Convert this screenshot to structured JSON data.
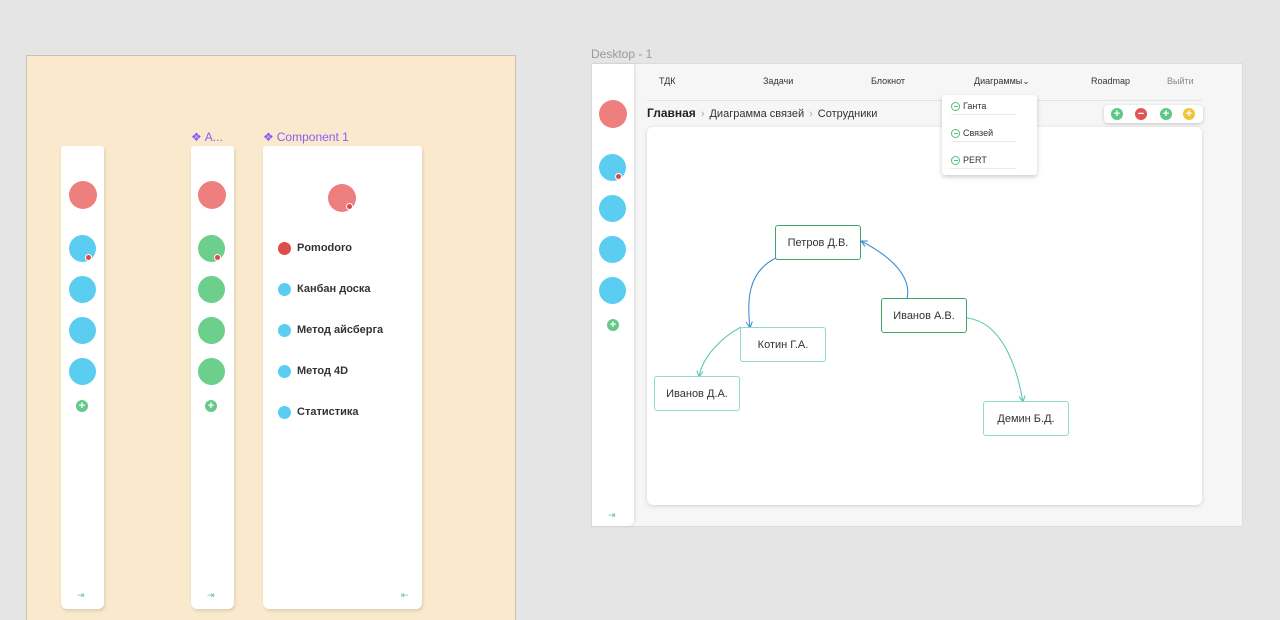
{
  "board": {
    "strip2_label": "A...",
    "component_label": "Component 1",
    "component_menu": [
      {
        "label": "Pomodoro",
        "color": "#e04b4b"
      },
      {
        "label": "Канбан доска",
        "color": "#5acdf0"
      },
      {
        "label": "Метод айсберга",
        "color": "#5acdf0"
      },
      {
        "label": "Метод 4D",
        "color": "#5acdf0"
      },
      {
        "label": "Статистика",
        "color": "#5acdf0"
      }
    ]
  },
  "desktop": {
    "frame_title": "Desktop - 1",
    "nav": {
      "tdk": "ТДК",
      "tasks": "Задачи",
      "notebook": "Блокнот",
      "diagrams": "Диаграммы",
      "diagrams_chevron": "⌄",
      "roadmap": "Roadmap",
      "logout": "Выйти"
    },
    "breadcrumb": {
      "home": "Главная",
      "sep": "›",
      "level2": "Диаграмма связей",
      "level3": "Сотрудники"
    },
    "dropdown": [
      "Ганта",
      "Связей",
      "PERT"
    ],
    "toolbar": {
      "add": "+",
      "remove": "−",
      "add2": "+",
      "add3": "+"
    },
    "nodes": {
      "petrov": "Петров Д.В.",
      "ivanov_av": "Иванов А.В.",
      "kotin": "Котин Г.А.",
      "ivanov_da": "Иванов Д.А.",
      "demin": "Демин Б.Д."
    }
  },
  "icons": {
    "plus": "+",
    "pin_right": "⇥",
    "pin_left": "⇤",
    "component": "❖"
  },
  "colors": {
    "board_bg": "#fae9cc",
    "avatar_red": "#ee7f7f",
    "blue": "#5acdf0",
    "green": "#6ccf8c",
    "badge_red": "#e0474b",
    "accent_purple": "#8b5cf6"
  }
}
